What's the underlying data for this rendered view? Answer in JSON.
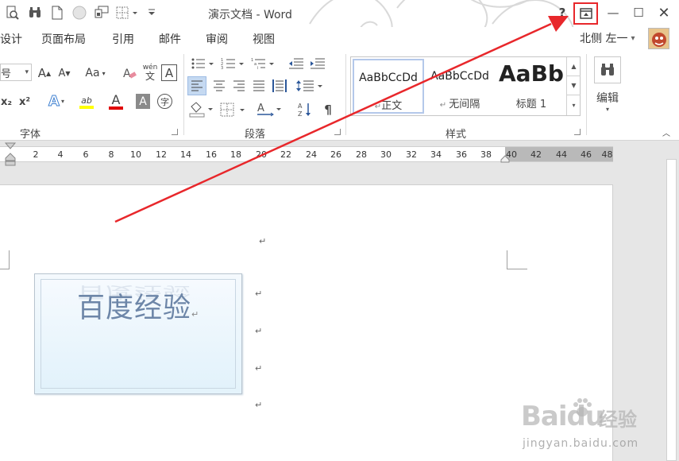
{
  "titlebar": {
    "title": "演示文档 - Word",
    "help": "?",
    "minimize": "—",
    "maximize": "☐",
    "close": "✕"
  },
  "tabs": [
    "设计",
    "页面布局",
    "引用",
    "邮件",
    "审阅",
    "视图"
  ],
  "user": {
    "name": "北侧 左一",
    "caret": "▾"
  },
  "font_group": {
    "label": "字体",
    "size_label": "号",
    "grow": "A",
    "shrink": "A",
    "change_case": "Aa",
    "phonetic_top": "wén",
    "phonetic_bottom": "文",
    "border_char": "A",
    "subscript": "x₂",
    "superscript": "x²",
    "effects": "A",
    "highlight": "ab",
    "font_color": "A",
    "shading": "A",
    "enclose": "字"
  },
  "paragraph_group": {
    "label": "段落"
  },
  "styles_group": {
    "label": "样式",
    "styles": [
      {
        "preview": "AaBbCcDd",
        "name": "正文"
      },
      {
        "preview": "AaBbCcDd",
        "name": "无间隔"
      },
      {
        "preview": "AaBb",
        "name": "标题 1"
      }
    ]
  },
  "editing_group": {
    "label": "编辑"
  },
  "ruler": {
    "ticks": [
      "2",
      "4",
      "6",
      "8",
      "10",
      "12",
      "14",
      "16",
      "18",
      "20",
      "22",
      "24",
      "26",
      "28",
      "30",
      "32",
      "34",
      "36",
      "38",
      "40",
      "42",
      "44",
      "46",
      "48"
    ]
  },
  "document": {
    "textbox_text": "百度经验",
    "para_mark": "↵"
  },
  "watermark": {
    "brand": "Baidu",
    "suffix": "经验",
    "url": "jingyan.baidu.com"
  },
  "colors": {
    "accent": "#2b579a",
    "annotation": "#e8272b",
    "text_blue": "#6d86a8"
  }
}
